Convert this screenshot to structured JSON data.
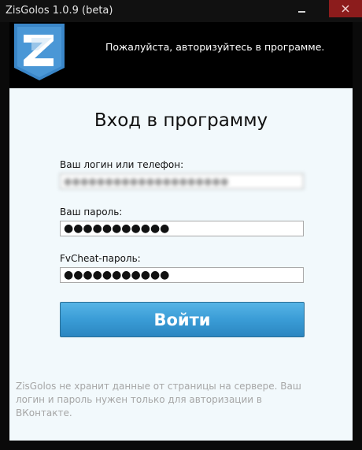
{
  "window": {
    "title": "ZisGolos 1.0.9 (beta)"
  },
  "header": {
    "logo_icon": "zisgolos-logo-icon",
    "message": "Пожалуйста, авторизуйтесь в программе."
  },
  "form": {
    "heading": "Вход в программу",
    "login": {
      "label": "Ваш логин или телефон:",
      "value": "●●●●●●●●●●●●●●●●●●●●"
    },
    "password": {
      "label": "Ваш пароль:",
      "value": "●●●●●●●●●●●"
    },
    "fvcheat_password": {
      "label": "FvCheat-пароль:",
      "value": "●●●●●●●●●●●"
    },
    "submit_label": "Войти"
  },
  "footer": {
    "note": "ZisGolos не хранит данные от страницы на сервере. Ваш логин и пароль нужен только для авторизации в ВКонтакте."
  },
  "colors": {
    "accent": "#3a9cd6",
    "logo_blue": "#3a86c8",
    "panel_bg": "#f2f9fc",
    "window_bg": "#0a0a0a",
    "close_button": "#8c1c1c"
  }
}
